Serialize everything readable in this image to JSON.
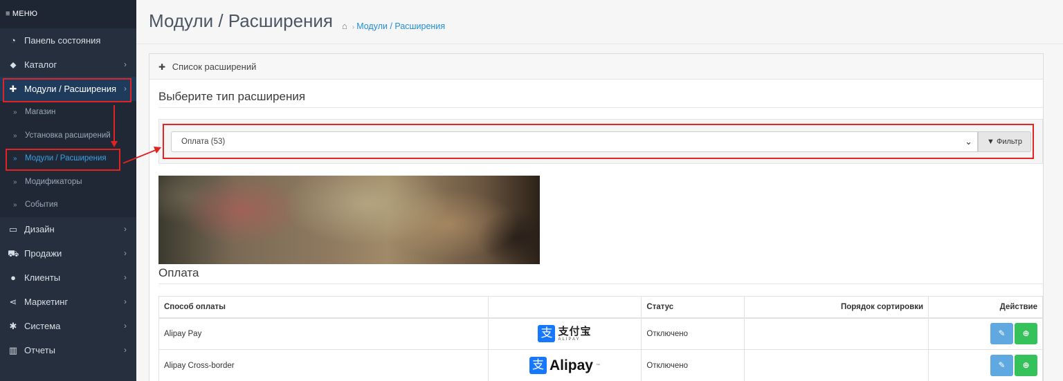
{
  "sidebar": {
    "menu_label": "≡ МЕНЮ",
    "items": [
      {
        "label": "Панель состояния",
        "icon": "dashboard-icon"
      },
      {
        "label": "Каталог",
        "icon": "tags-icon"
      },
      {
        "label": "Модули / Расширения",
        "icon": "puzzle-icon"
      },
      {
        "label": "Дизайн",
        "icon": "monitor-icon"
      },
      {
        "label": "Продажи",
        "icon": "cart-icon"
      },
      {
        "label": "Клиенты",
        "icon": "user-icon"
      },
      {
        "label": "Маркетинг",
        "icon": "share-icon"
      },
      {
        "label": "Система",
        "icon": "gear-icon"
      },
      {
        "label": "Отчеты",
        "icon": "bar-chart-icon"
      }
    ],
    "submenu": [
      {
        "label": "Магазин"
      },
      {
        "label": "Установка расширений"
      },
      {
        "label": "Модули / Расширения"
      },
      {
        "label": "Модификаторы"
      },
      {
        "label": "События"
      }
    ]
  },
  "header": {
    "title": "Модули / Расширения",
    "breadcrumb": "Модули / Расширения"
  },
  "panel": {
    "heading": "Список расширений",
    "choose_type": "Выберите тип расширения",
    "select_value": "Оплата (53)",
    "filter_label": "Фильтр",
    "section_title": "Оплата"
  },
  "table": {
    "headers": [
      "Способ оплаты",
      "",
      "Статус",
      "Порядок сортировки",
      "Действие"
    ],
    "rows": [
      {
        "name": "Alipay Pay",
        "logo_cn": "支付宝",
        "logo_en": "ALIPAY",
        "status": "Отключено",
        "sort": ""
      },
      {
        "name": "Alipay Cross-border",
        "logo_text": "Alipay",
        "status": "Отключено",
        "sort": ""
      }
    ]
  },
  "colors": {
    "sidebar_bg": "#252f3d",
    "active_bg": "#1f3b5c",
    "link": "#1e8fd8",
    "edit_button": "#5fa8e0",
    "install_button": "#35c25b",
    "annotation": "#e52222",
    "alipay_blue": "#1677ff"
  }
}
